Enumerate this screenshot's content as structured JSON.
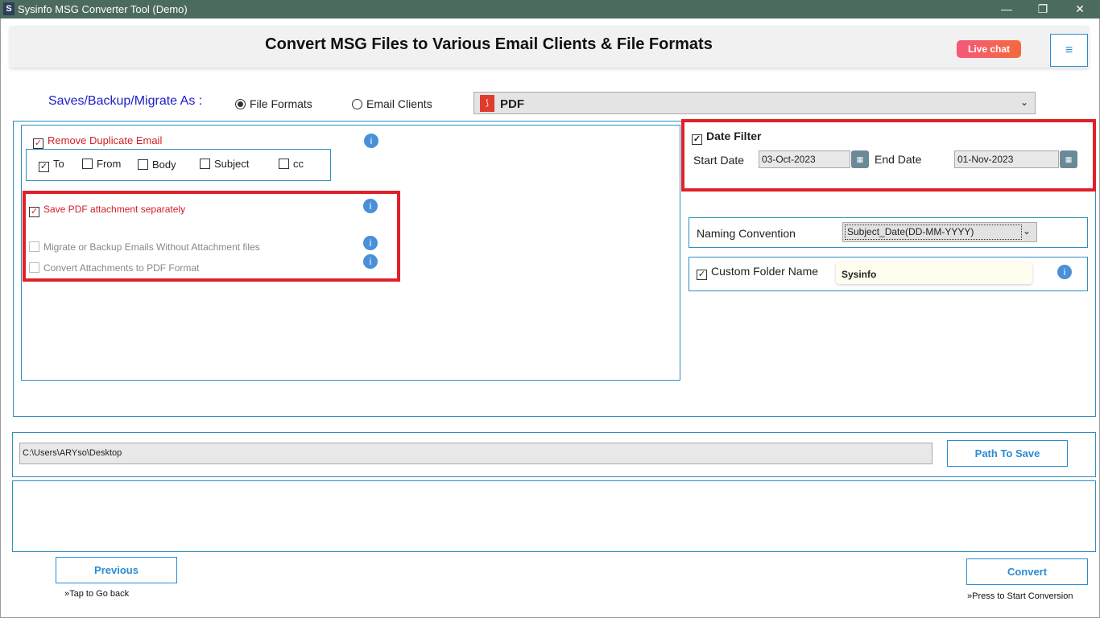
{
  "window": {
    "title": "Sysinfo MSG Converter Tool (Demo)",
    "logo": "S",
    "minimize": "—",
    "restore": "❐",
    "close": "✕"
  },
  "header": {
    "title": "Convert MSG Files to Various Email Clients & File Formats",
    "live_chat": "Live chat",
    "menu_icon": "≡"
  },
  "save_as": {
    "label": "Saves/Backup/Migrate As :",
    "options": [
      "File Formats",
      "Email Clients"
    ],
    "selected": "File Formats",
    "format": "PDF"
  },
  "left": {
    "remove_duplicate": "Remove Duplicate Email",
    "dup_fields": [
      "To",
      "From",
      "Body",
      "Subject",
      "cc"
    ],
    "save_pdf_attach": "Save PDF attachment separately",
    "migrate_without": "Migrate or Backup Emails Without Attachment files",
    "convert_attach": "Convert Attachments to PDF Format"
  },
  "right": {
    "date_filter": "Date Filter",
    "start_label": "Start Date",
    "start_value": "03-Oct-2023",
    "end_label": "End Date",
    "end_value": "01-Nov-2023",
    "naming_label": "Naming Convention",
    "naming_value": "Subject_Date(DD-MM-YYYY)",
    "custom_folder_label": "Custom Folder Name",
    "custom_folder_value": "Sysinfo"
  },
  "path": {
    "value": "C:\\Users\\ARYso\\Desktop",
    "button": "Path To Save"
  },
  "footer": {
    "previous": "Previous",
    "previous_hint": "»Tap to Go back",
    "convert": "Convert",
    "convert_hint": "»Press to Start Conversion"
  },
  "colors": {
    "titlebar": "#4b6b5e",
    "accent": "#2a8bd2",
    "highlight": "#e0202a"
  }
}
